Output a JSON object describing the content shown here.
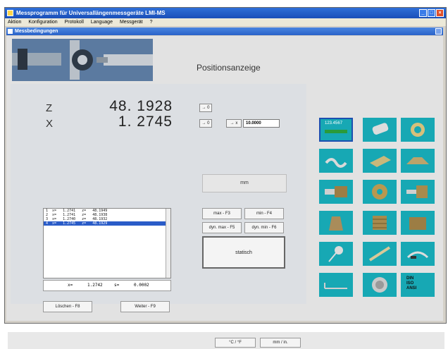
{
  "window": {
    "title": "Messprogramm für Universallängenmessgeräte LMI-MS"
  },
  "menu": {
    "items": [
      "Aktion",
      "Konfiguration",
      "Protokoll",
      "Language",
      "Messgerät",
      "?"
    ]
  },
  "dialog": {
    "title": "Messbedingungen"
  },
  "header": {
    "title": "Positionsanzeige"
  },
  "axes": [
    {
      "label": "Z",
      "value": "48. 1928"
    },
    {
      "label": "X",
      "value": "1. 2745"
    }
  ],
  "zero_buttons": {
    "z_zero": "→ 0",
    "x_zero": "→ 0",
    "x_set": "→ x",
    "x_set_value": "10.0000"
  },
  "unit_display": "mm",
  "buttons": {
    "max": "max - F3",
    "min": "min - F4",
    "dyn_max": "dyn. max - F5",
    "dyn_min": "dyn. min - F6",
    "static": "statisch",
    "clear": "Löschen - F8",
    "next": "Weiter - F9",
    "celsius_fahrenheit": "°C / °F",
    "mm_in": "mm / in."
  },
  "list": {
    "rows": [
      "1  x=   1.2741   z=   48.1949",
      "2  x=   1.2741   z=   48.1938",
      "3  x=   1.2740   z=   48.1932",
      "4  x=   1.2745   z=   48.1929"
    ],
    "selected_index": 3
  },
  "summary": {
    "x_label": "x=",
    "x_value": "1.2742",
    "s_label": "s=",
    "s_value": "0.0002"
  },
  "tiles": {
    "first_value": "123.4567",
    "din_line1": "DIN",
    "din_line2": "ISO",
    "din_line3": "ANSI"
  },
  "colors": {
    "tile": "#17a8b4",
    "selection": "#2a5cc8",
    "titlebar": "#1a4fb8"
  }
}
